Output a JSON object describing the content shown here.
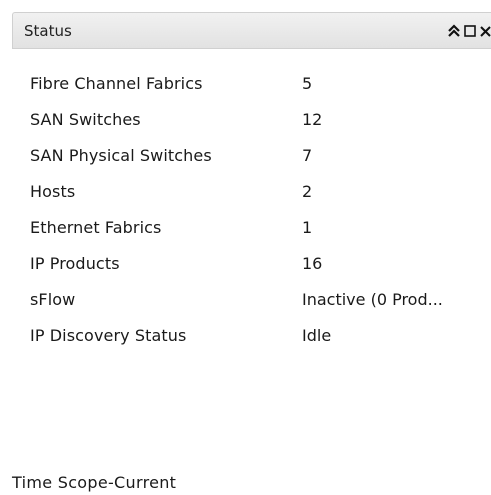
{
  "panel": {
    "title": "Status",
    "controls": [
      "collapse-icon",
      "maximize-icon",
      "close-icon"
    ]
  },
  "rows": [
    {
      "label": "Fibre Channel Fabrics",
      "value": "5"
    },
    {
      "label": "SAN Switches",
      "value": "12"
    },
    {
      "label": "SAN Physical Switches",
      "value": "7"
    },
    {
      "label": "Hosts",
      "value": "2"
    },
    {
      "label": "Ethernet Fabrics",
      "value": "1"
    },
    {
      "label": "IP Products",
      "value": "16"
    },
    {
      "label": "sFlow",
      "value": "Inactive (0 Prod..."
    },
    {
      "label": "IP Discovery Status",
      "value": "Idle"
    }
  ],
  "footer": {
    "text": "Time Scope-Current"
  }
}
